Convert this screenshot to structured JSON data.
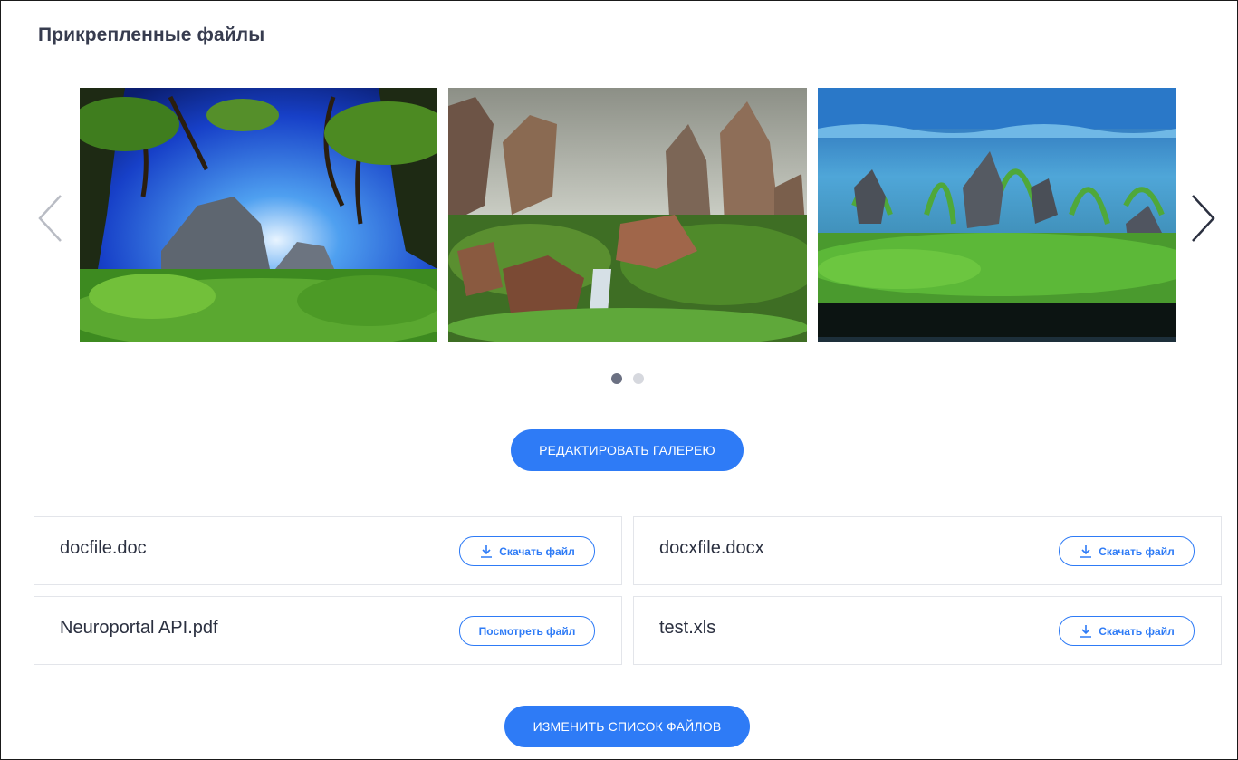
{
  "section": {
    "title": "Прикрепленные файлы"
  },
  "gallery": {
    "slides": [
      {
        "name": "aquarium-forest-image"
      },
      {
        "name": "aquarium-rocks-image"
      },
      {
        "name": "aquarium-grass-image"
      }
    ],
    "prev_icon": "chevron-left-icon",
    "next_icon": "chevron-right-icon",
    "pages": 2,
    "active_page": 1,
    "edit_label": "РЕДАКТИРОВАТЬ ГАЛЕРЕЮ"
  },
  "files": {
    "items": [
      {
        "name": "docfile.doc",
        "action_label": "Скачать файл",
        "icon": "download-icon"
      },
      {
        "name": "docxfile.docx",
        "action_label": "Скачать файл",
        "icon": "download-icon"
      },
      {
        "name": "Neuroportal API.pdf",
        "action_label": "Посмотреть файл",
        "icon": ""
      },
      {
        "name": "test.xls",
        "action_label": "Скачать файл",
        "icon": "download-icon"
      }
    ],
    "edit_label": "ИЗМЕНИТЬ СПИСОК ФАЙЛОВ"
  },
  "colors": {
    "accent": "#2e7bf6",
    "title_text": "#373c4f",
    "dot_active": "#6b7082",
    "dot_inactive": "#d6d8de"
  }
}
